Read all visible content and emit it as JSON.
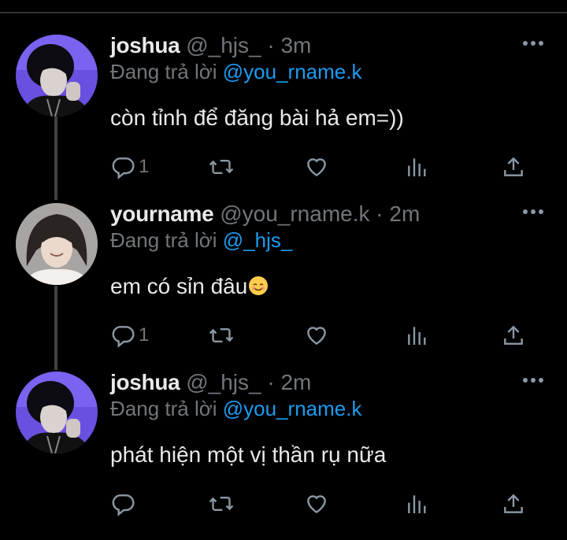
{
  "tweets": [
    {
      "name": "joshua",
      "handle": "@_hjs_",
      "dot": " · ",
      "time": "3m",
      "reply_prefix": "Đang trả lời ",
      "reply_to": "@you_rname.k",
      "text": "còn tỉnh để đăng bài hả em=))",
      "reply_count": "1",
      "avatar": "dark-haired-man-purple-bg"
    },
    {
      "name": "yourname",
      "handle": "@you_rname.k",
      "dot": " · ",
      "time": "2m",
      "reply_prefix": "Đang trả lời ",
      "reply_to": "@_hjs_",
      "text": "em có sỉn đâu",
      "emoji": "smiling-face-emoji",
      "reply_count": "1",
      "avatar": "smiling-person-gray-bg"
    },
    {
      "name": "joshua",
      "handle": "@_hjs_",
      "dot": " · ",
      "time": "2m",
      "reply_prefix": "Đang trả lời ",
      "reply_to": "@you_rname.k",
      "text": "phát hiện một vị thần rụ nữa",
      "reply_count": "",
      "avatar": "dark-haired-man-purple-bg"
    }
  ],
  "colors": {
    "background": "#000000",
    "text": "#e7e9ea",
    "secondary": "#71767b",
    "mention": "#1d9bf0",
    "thread_line": "#3e4144"
  },
  "icons": [
    "reply-icon",
    "retweet-icon",
    "like-icon",
    "views-icon",
    "share-icon",
    "more-icon"
  ]
}
